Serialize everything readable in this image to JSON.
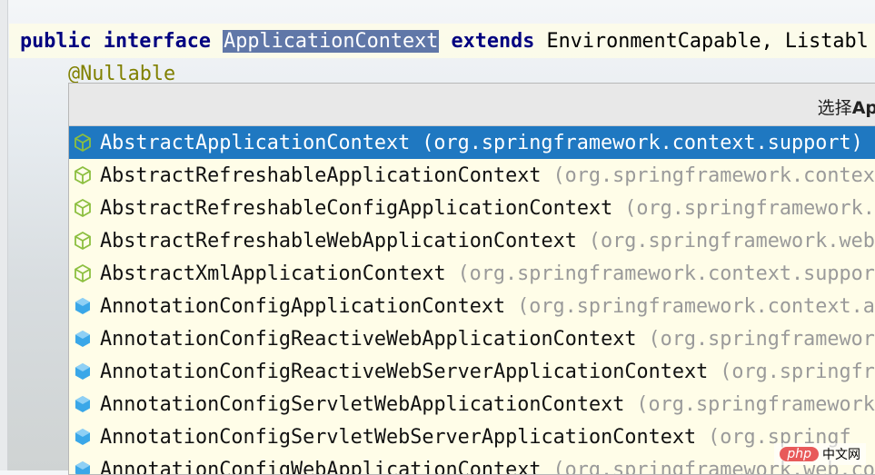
{
  "editor": {
    "code_tokens": {
      "kw1": "public",
      "kw2": "interface",
      "name": "ApplicationContext",
      "kw3": "extends",
      "rest": "EnvironmentCapable, Listabl"
    },
    "annotation": "@Nullable"
  },
  "popup": {
    "title_prefix": "选择",
    "title_bold": "Ap",
    "items": [
      {
        "name": "AbstractApplicationContext",
        "package": "(org.springframework.context.support)",
        "icon": "abstract-class-icon",
        "selected": true
      },
      {
        "name": "AbstractRefreshableApplicationContext",
        "package": "(org.springframework.contex",
        "icon": "abstract-class-icon"
      },
      {
        "name": "AbstractRefreshableConfigApplicationContext",
        "package": "(org.springframework.",
        "icon": "abstract-class-icon"
      },
      {
        "name": "AbstractRefreshableWebApplicationContext",
        "package": "(org.springframework.web",
        "icon": "abstract-class-icon"
      },
      {
        "name": "AbstractXmlApplicationContext",
        "package": "(org.springframework.context.suppor",
        "icon": "abstract-class-icon"
      },
      {
        "name": "AnnotationConfigApplicationContext",
        "package": "(org.springframework.context.a",
        "icon": "class-icon"
      },
      {
        "name": "AnnotationConfigReactiveWebApplicationContext",
        "package": "(org.springframewor",
        "icon": "class-icon"
      },
      {
        "name": "AnnotationConfigReactiveWebServerApplicationContext",
        "package": "(org.springfr",
        "icon": "class-icon"
      },
      {
        "name": "AnnotationConfigServletWebApplicationContext",
        "package": "(org.springframework",
        "icon": "class-icon"
      },
      {
        "name": "AnnotationConfigServletWebServerApplicationContext",
        "package": "(org.springf",
        "icon": "class-icon"
      },
      {
        "name": "AnnotationConfigWebApplicationContext",
        "package": "(org.springframework.web.co",
        "icon": "class-icon"
      }
    ]
  },
  "watermark": {
    "php": "php",
    "site": "中文网"
  },
  "colors": {
    "selection": "#1f78c1",
    "keyword": "#000080",
    "annotation": "#808000"
  }
}
